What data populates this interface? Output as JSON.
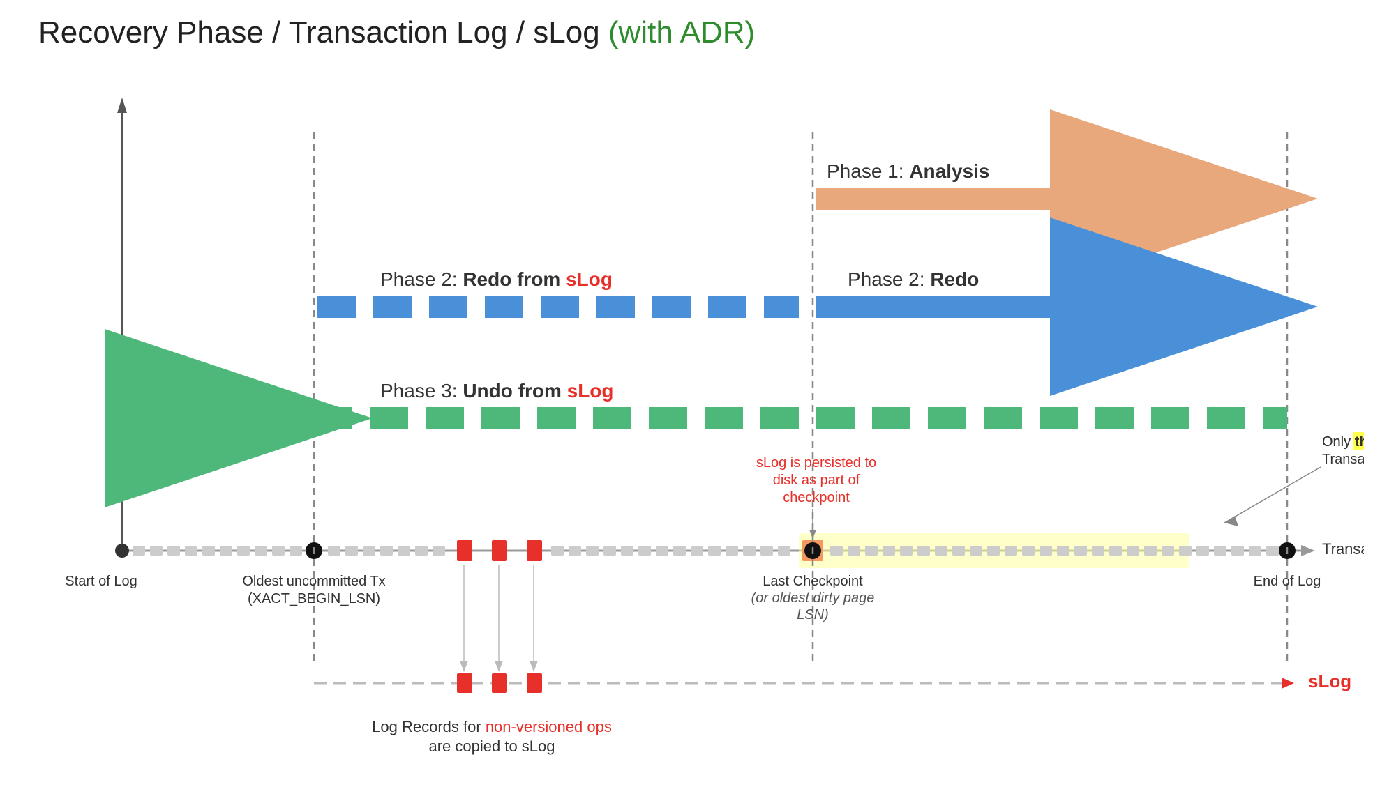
{
  "title": {
    "part1": "Recovery Phase / Transaction Log / sLog ",
    "part2": "(with ADR)"
  },
  "phases": {
    "phase1": {
      "label": "Phase 1:",
      "bold": "Analysis",
      "color": "#e8a87c"
    },
    "phase2_slog": {
      "label": "Phase 2:",
      "bold": "Redo from",
      "slog": "sLog",
      "color": "#4a90d9"
    },
    "phase2_redo": {
      "label": "Phase 2:",
      "bold": "Redo",
      "color": "#4a90d9"
    },
    "phase3_slog": {
      "label": "Phase 3:",
      "bold": "Undo from",
      "slog": "sLog",
      "color": "#4db87a"
    }
  },
  "log_labels": {
    "start": "Start of Log",
    "oldest_tx": "Oldest uncommitted Tx",
    "xact_begin": "(XACT_BEGIN_LSN)",
    "last_checkpoint": "Last Checkpoint",
    "last_checkpoint_sub": "(or oldest dirty page",
    "last_checkpoint_sub2": "LSN)",
    "end_of_log": "End of Log",
    "transaction_log": "Transaction Log",
    "slog_label": "sLog"
  },
  "annotations": {
    "slog_persisted": "sLog is persisted to\ndisk as part of\ncheckpoint",
    "this_portion": "Only this portion of the\nTransaction Log is scanned.",
    "log_records": "Log Records for",
    "non_versioned": "non-versioned ops",
    "are_copied": "are copied to sLog"
  }
}
